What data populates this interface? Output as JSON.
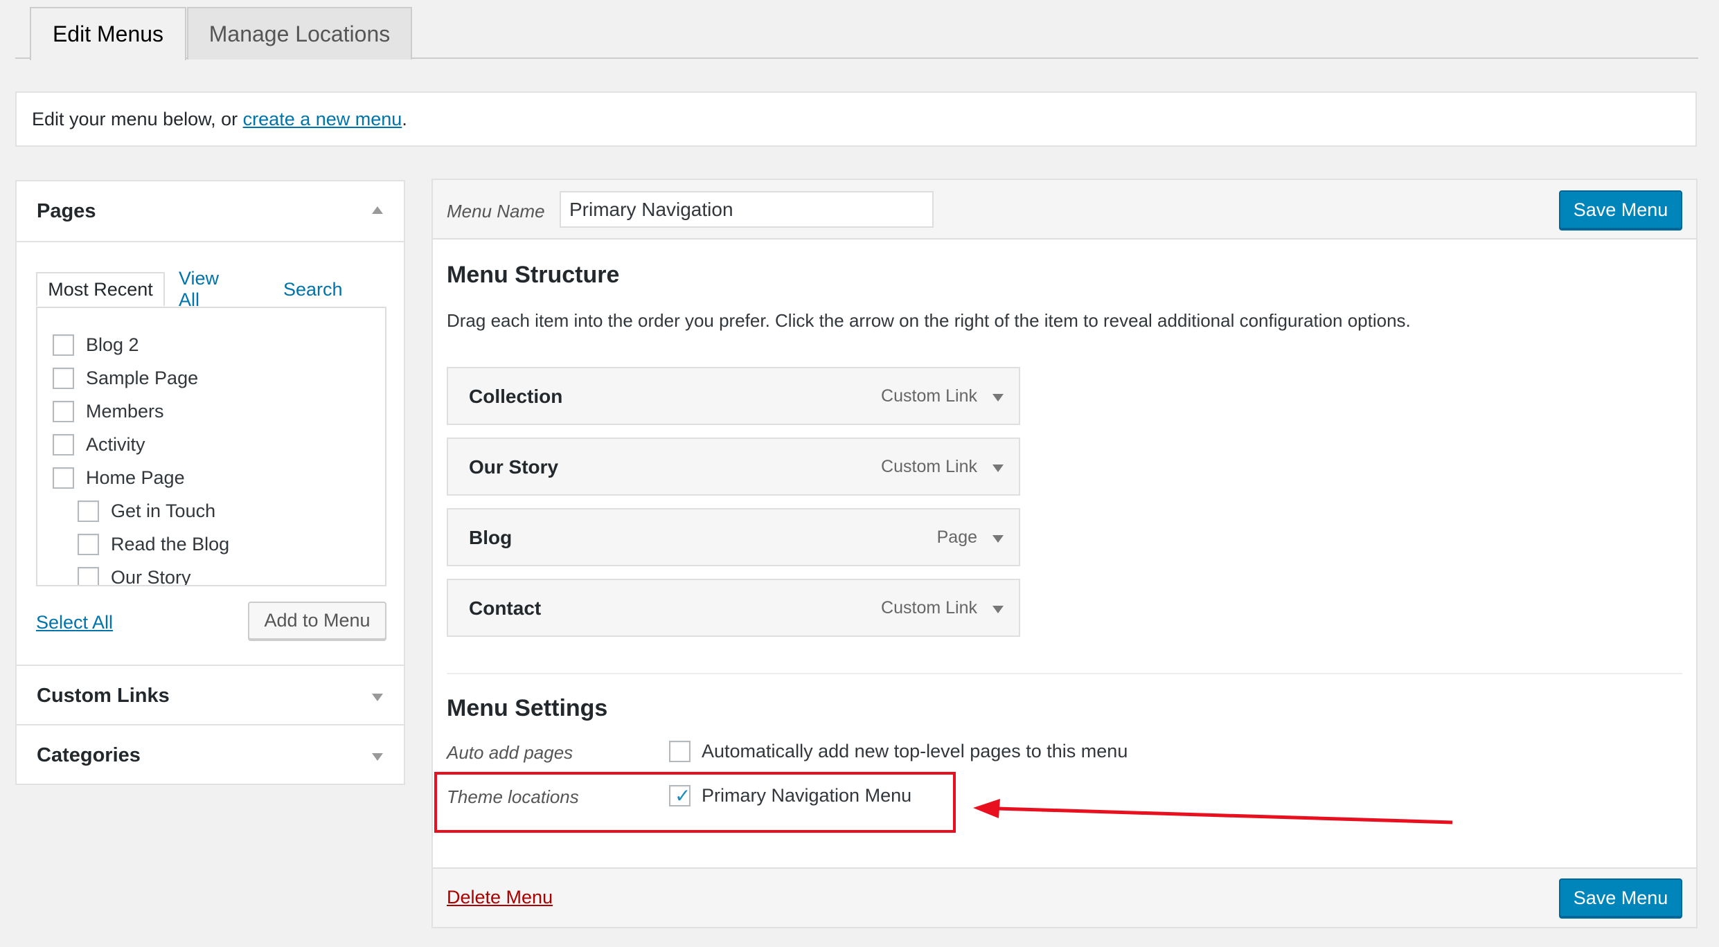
{
  "tabs": [
    {
      "label": "Edit Menus",
      "active": true
    },
    {
      "label": "Manage Locations",
      "active": false
    }
  ],
  "notice": {
    "prefix": "Edit your menu below, or ",
    "link": "create a new menu",
    "suffix": "."
  },
  "sidebar": {
    "pages": {
      "title": "Pages",
      "tabs": [
        "Most Recent",
        "View All",
        "Search"
      ],
      "items": [
        {
          "label": "Blog 2",
          "checked": false,
          "indent": 0
        },
        {
          "label": "Sample Page",
          "checked": false,
          "indent": 0
        },
        {
          "label": "Members",
          "checked": false,
          "indent": 0
        },
        {
          "label": "Activity",
          "checked": false,
          "indent": 0
        },
        {
          "label": "Home Page",
          "checked": false,
          "indent": 0
        },
        {
          "label": "Get in Touch",
          "checked": false,
          "indent": 1
        },
        {
          "label": "Read the Blog",
          "checked": false,
          "indent": 1
        },
        {
          "label": "Our Story",
          "checked": false,
          "indent": 1
        }
      ],
      "select_all": "Select All",
      "add_button": "Add to Menu"
    },
    "custom_links": {
      "title": "Custom Links"
    },
    "categories": {
      "title": "Categories"
    }
  },
  "main": {
    "menu_name_label": "Menu Name",
    "menu_name_value": "Primary Navigation",
    "save_label": "Save Menu",
    "structure_title": "Menu Structure",
    "structure_desc": "Drag each item into the order you prefer. Click the arrow on the right of the item to reveal additional configuration options.",
    "menu_items": [
      {
        "title": "Collection",
        "type": "Custom Link"
      },
      {
        "title": "Our Story",
        "type": "Custom Link"
      },
      {
        "title": "Blog",
        "type": "Page"
      },
      {
        "title": "Contact",
        "type": "Custom Link"
      }
    ],
    "settings_title": "Menu Settings",
    "auto_add_label": "Auto add pages",
    "auto_add_option": "Automatically add new top-level pages to this menu",
    "auto_add_checked": false,
    "theme_locations_label": "Theme locations",
    "theme_location_option": "Primary Navigation Menu",
    "theme_location_checked": true,
    "delete_label": "Delete Menu"
  },
  "colors": {
    "primary": "#0085ba",
    "link": "#0073aa",
    "delete": "#a00",
    "annotation": "#e8101f"
  }
}
